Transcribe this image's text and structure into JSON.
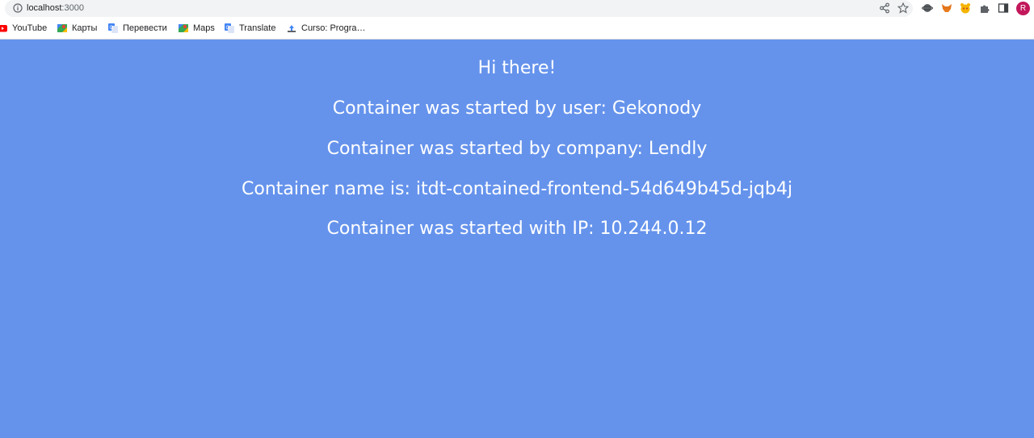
{
  "browser": {
    "url_host": "localhost",
    "url_port": ":3000",
    "profile_initial": "R"
  },
  "bookmarks": [
    {
      "label": "YouTube",
      "icon": "youtube-icon"
    },
    {
      "label": "Карты",
      "icon": "google-maps-icon"
    },
    {
      "label": "Перевести",
      "icon": "google-translate-icon"
    },
    {
      "label": "Maps",
      "icon": "google-maps-icon"
    },
    {
      "label": "Translate",
      "icon": "google-translate-icon"
    },
    {
      "label": "Curso: Progra…",
      "icon": "course-icon"
    }
  ],
  "page": {
    "background": "#6593ec",
    "lines": [
      "Hi there!",
      "Container was started by user: Gekonody",
      "Container was started by company: Lendly",
      "Container name is: itdt-contained-frontend-54d649b45d-jqb4j",
      "Container was started with IP: 10.244.0.12"
    ]
  }
}
